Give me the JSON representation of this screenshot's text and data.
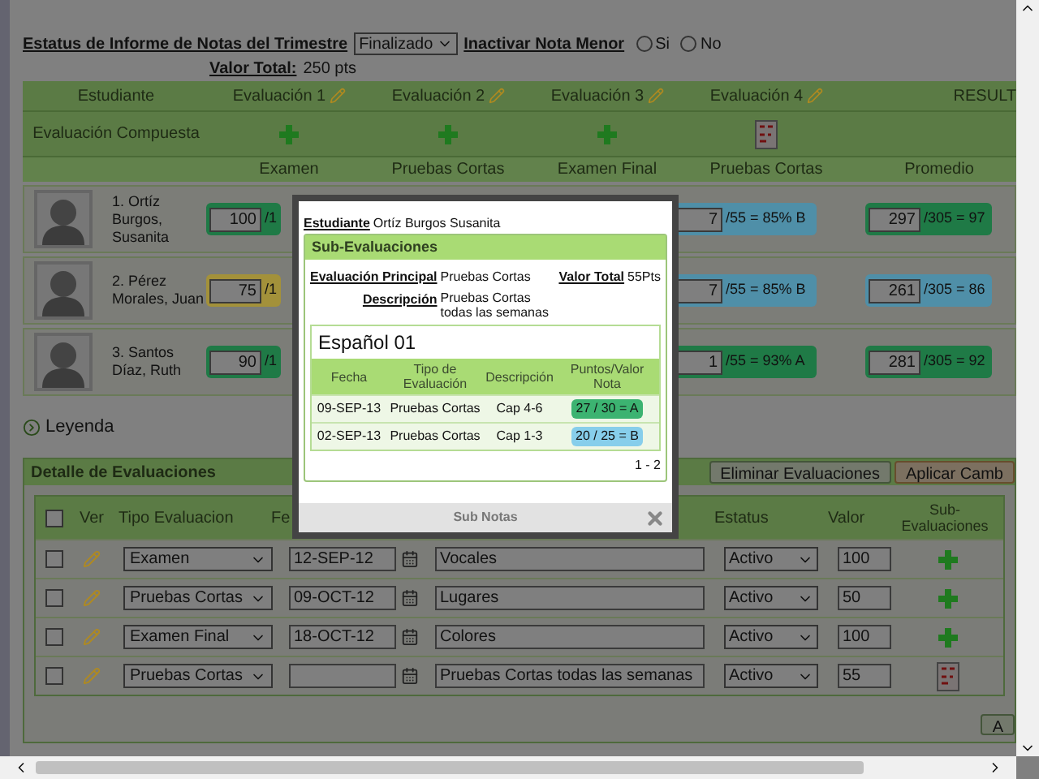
{
  "header": {
    "status_label": "Estatus de Informe de Notas del Trimestre",
    "status_value": "Finalizado",
    "inactivate_label": "Inactivar Nota Menor",
    "options": [
      {
        "label": "Si",
        "selected": false
      },
      {
        "label": "No",
        "selected": false
      }
    ],
    "total_label": "Valor Total:",
    "total_value": "250 pts"
  },
  "grades_table": {
    "columns": [
      "Estudiante",
      "Evaluación 1",
      "Evaluación 2",
      "Evaluación 3",
      "Evaluación 4",
      "RESULT"
    ],
    "composite_label": "Evaluación Compuesta",
    "composite": [
      {
        "kind": "add"
      },
      {
        "kind": "add"
      },
      {
        "kind": "add"
      },
      {
        "kind": "grades"
      }
    ],
    "types": [
      "Examen",
      "Pruebas Cortas",
      "Examen Final",
      "Pruebas Cortas",
      "Promedio"
    ],
    "rows": [
      {
        "name": "1. Ortíz Burgos, Susanita",
        "eval1": {
          "value": "100",
          "suffix": "/1",
          "color": "#1f7a46"
        },
        "eval4": {
          "value": "7",
          "suffix": "/55 = 85% B",
          "color": "#4f8fa8"
        },
        "average": {
          "value": "297",
          "suffix": "/305 = 97",
          "color": "#1f7a46"
        }
      },
      {
        "name": "2. Pérez Morales, Juan",
        "eval1": {
          "value": "75",
          "suffix": "/1",
          "color": "#a3913a"
        },
        "eval4": {
          "value": "7",
          "suffix": "/55 = 85% B",
          "color": "#4f8fa8"
        },
        "average": {
          "value": "261",
          "suffix": "/305 = 86",
          "color": "#4f8fa8"
        }
      },
      {
        "name": "3. Santos Díaz, Ruth",
        "eval1": {
          "value": "90",
          "suffix": "/1",
          "color": "#1f7a46"
        },
        "eval4": {
          "value": "1",
          "suffix": "/55 = 93% A",
          "color": "#1f7a46"
        },
        "average": {
          "value": "281",
          "suffix": "/305 = 92",
          "color": "#1f7a46"
        }
      }
    ]
  },
  "legend": {
    "label": "Leyenda"
  },
  "details": {
    "title": "Detalle de Evaluaciones",
    "buttons": [
      "Eliminar Evaluaciones",
      "Aplicar Camb"
    ],
    "select_all": {
      "checked": false
    },
    "columns": {
      "view": "Ver",
      "type": "Tipo Evaluacion",
      "date": "Fe",
      "status": "Estatus",
      "value": "Valor",
      "sub": "Sub-Evaluaciones"
    },
    "rows": [
      {
        "checked": false,
        "type": "Examen",
        "date": "12-SEP-12",
        "description": "Vocales",
        "status": "Activo",
        "value": "100",
        "kind": "add"
      },
      {
        "checked": false,
        "type": "Pruebas Cortas",
        "date": "09-OCT-12",
        "description": "Lugares",
        "status": "Activo",
        "value": "50",
        "kind": "add"
      },
      {
        "checked": false,
        "type": "Examen Final",
        "date": "18-OCT-12",
        "description": "Colores",
        "status": "Activo",
        "value": "100",
        "kind": "add"
      },
      {
        "checked": false,
        "type": "Pruebas Cortas",
        "date": "",
        "description": "Pruebas Cortas todas las semanas",
        "status": "Activo",
        "value": "55",
        "kind": "grades"
      }
    ],
    "bottom_button": "A"
  },
  "modal": {
    "student_label": "Estudiante",
    "student": "Ortíz Burgos Susanita",
    "panel_title": "Sub-Evaluaciones",
    "main_label": "Evaluación Principal",
    "main_value": "Pruebas Cortas",
    "total_label": "Valor Total",
    "total_value": "55Pts",
    "description_label": "Descripción",
    "description_value": "Pruebas Cortas todas las semanas",
    "course": "Español 01",
    "columns": [
      "Fecha",
      "Tipo de Evaluación",
      "Descripción",
      "Puntos/Valor Nota"
    ],
    "rows": [
      {
        "date": "09-SEP-13",
        "type": "Pruebas Cortas",
        "description": "Cap 4-6",
        "score": "27 / 30 = A",
        "color": "#3cb371"
      },
      {
        "date": "02-SEP-13",
        "type": "Pruebas Cortas",
        "description": "Cap 1-3",
        "score": "20 / 25 = B",
        "color": "#87ceeb"
      }
    ],
    "pager": "1 - 2",
    "footer": "Sub Notas"
  }
}
